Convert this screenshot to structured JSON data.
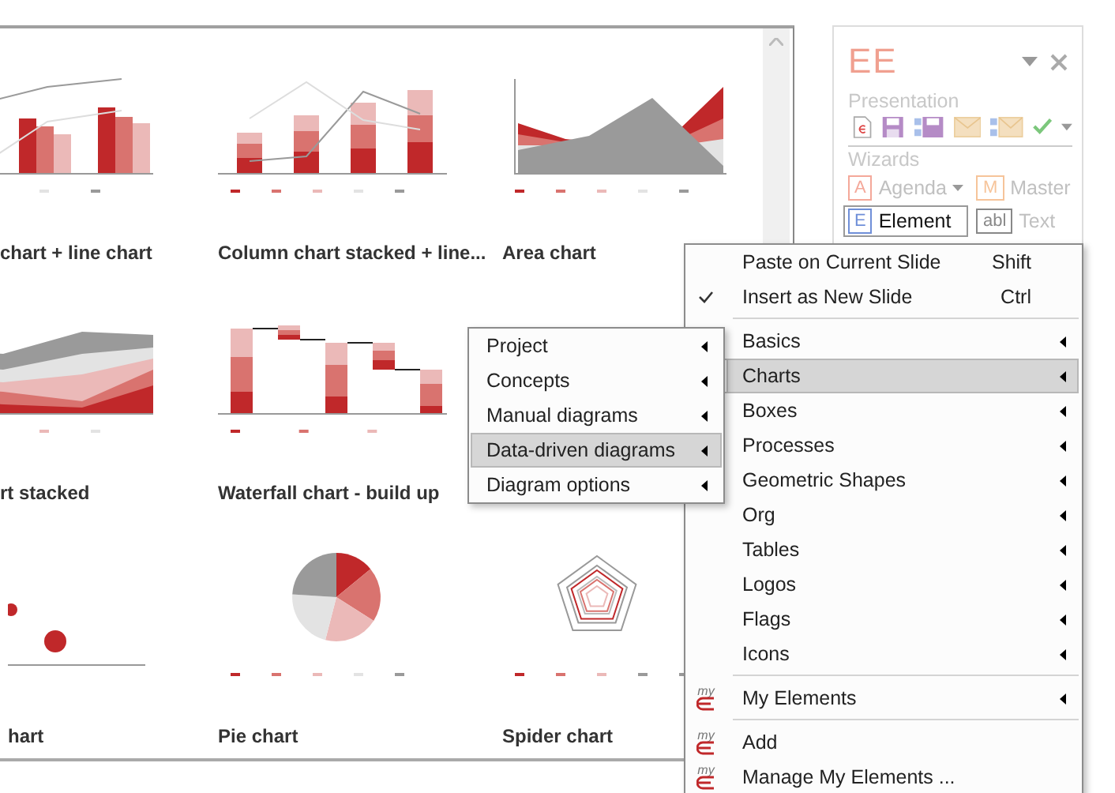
{
  "gallery": {
    "tiles": [
      {
        "kind": "column-line",
        "title": "chart + line chart"
      },
      {
        "kind": "stacked-column-line",
        "title": "Column chart stacked + line..."
      },
      {
        "kind": "area",
        "title": "Area chart"
      },
      {
        "kind": "stacked-area",
        "title": "rt stacked"
      },
      {
        "kind": "waterfall",
        "title": "Waterfall chart - build up"
      },
      {
        "kind": "bubble",
        "title": "hart"
      },
      {
        "kind": "pie",
        "title": "Pie chart"
      },
      {
        "kind": "spider",
        "title": "Spider chart"
      }
    ]
  },
  "ee_panel": {
    "logo": "EE",
    "presentation_label": "Presentation",
    "wizards_label": "Wizards",
    "wizards": [
      {
        "label": "Agenda",
        "icon_letter": "A",
        "color": "#f4a89a",
        "has_dropdown": true,
        "selected": false
      },
      {
        "label": "Master",
        "icon_letter": "M",
        "color": "#f6c49a",
        "has_dropdown": false,
        "selected": false
      },
      {
        "label": "Element",
        "icon_letter": "E",
        "color": "#6f8fd8",
        "has_dropdown": false,
        "selected": true
      },
      {
        "label": "Text",
        "icon_letter": "abl",
        "color": "#888888",
        "has_dropdown": false,
        "selected": false
      }
    ]
  },
  "menu": {
    "items": [
      {
        "kind": "command",
        "label": "Paste on Current Slide",
        "shortcut": "Shift",
        "checked": false,
        "selected": false
      },
      {
        "kind": "command",
        "label": "Insert as New Slide",
        "shortcut": "Ctrl",
        "checked": true,
        "selected": false
      },
      {
        "kind": "separator"
      },
      {
        "kind": "submenu",
        "label": "Basics",
        "selected": false
      },
      {
        "kind": "submenu",
        "label": "Charts",
        "selected": true
      },
      {
        "kind": "submenu",
        "label": "Boxes",
        "selected": false
      },
      {
        "kind": "submenu",
        "label": "Processes",
        "selected": false
      },
      {
        "kind": "submenu",
        "label": "Geometric Shapes",
        "selected": false
      },
      {
        "kind": "submenu",
        "label": "Org",
        "selected": false
      },
      {
        "kind": "submenu",
        "label": "Tables",
        "selected": false
      },
      {
        "kind": "submenu",
        "label": "Logos",
        "selected": false
      },
      {
        "kind": "submenu",
        "label": "Flags",
        "selected": false
      },
      {
        "kind": "submenu",
        "label": "Icons",
        "selected": false
      },
      {
        "kind": "separator"
      },
      {
        "kind": "submenu",
        "label": "My Elements",
        "icon_text": "my",
        "selected": false
      },
      {
        "kind": "separator"
      },
      {
        "kind": "command",
        "label": "Add",
        "icon_text": "my",
        "checked": false,
        "selected": false
      },
      {
        "kind": "command",
        "label": "Manage My Elements ...",
        "icon_text": "my",
        "checked": false,
        "selected": false
      }
    ]
  },
  "submenu": {
    "items": [
      {
        "label": "Project",
        "selected": false
      },
      {
        "label": "Concepts",
        "selected": false
      },
      {
        "label": "Manual diagrams",
        "selected": false
      },
      {
        "label": "Data-driven diagrams",
        "selected": true
      },
      {
        "label": "Diagram options",
        "selected": false
      }
    ]
  }
}
